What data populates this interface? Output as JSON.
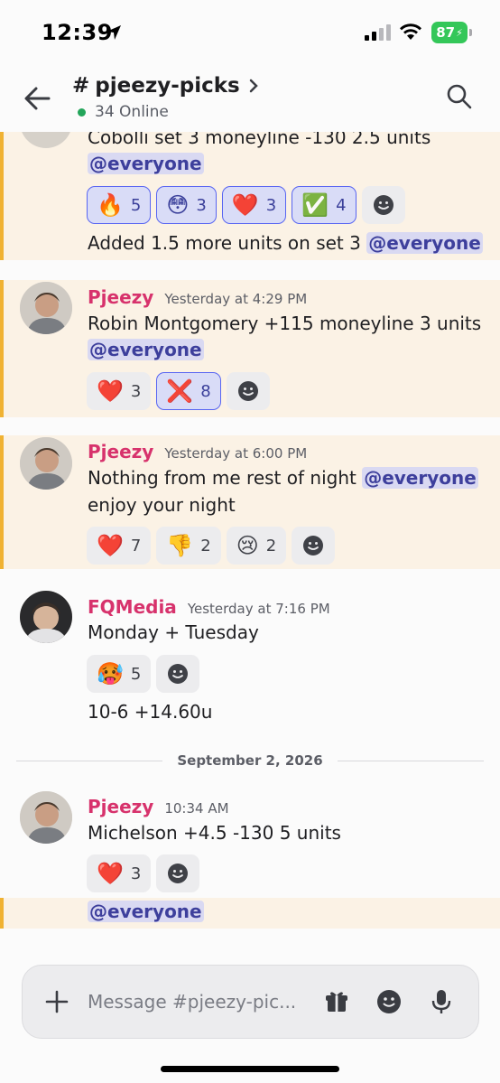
{
  "status_bar": {
    "time": "12:39",
    "battery": "87"
  },
  "header": {
    "channel_hash": "#",
    "channel_name": "pjeezy-picks",
    "online": "34 Online"
  },
  "messages": [
    {
      "lines": [
        "Cobolli set 3 moneyline -130 2.5 units"
      ],
      "mention_line": "@everyone",
      "reactions": [
        {
          "emoji": "🔥",
          "count": "5"
        },
        {
          "emoji": "😳",
          "count": "3"
        },
        {
          "emoji": "❤️",
          "count": "3"
        },
        {
          "emoji": "✅",
          "count": "4"
        }
      ],
      "followup_text": "Added 1.5 more units on set 3 ",
      "followup_mention": "@everyone"
    },
    {
      "author": "Pjeezy",
      "time": "Yesterday at 4:29 PM",
      "text": "Robin Montgomery +115 moneyline 3 units",
      "mention": "@everyone",
      "reactions": [
        {
          "emoji": "❤️",
          "count": "3"
        },
        {
          "emoji": "❌",
          "count": "8"
        }
      ]
    },
    {
      "author": "Pjeezy",
      "time": "Yesterday at 6:00 PM",
      "text": "Nothing from me rest of night ",
      "mention": "@everyone",
      "text2": "enjoy your night",
      "reactions": [
        {
          "emoji": "❤️",
          "count": "7"
        },
        {
          "emoji": "👎",
          "count": "2"
        },
        {
          "emoji": "😢",
          "count": "2"
        }
      ]
    },
    {
      "author": "FQMedia",
      "time": "Yesterday at 7:16 PM",
      "text": "Monday + Tuesday",
      "reactions": [
        {
          "emoji": "🥵",
          "count": "5"
        }
      ],
      "followup_text": "10-6 +14.60u"
    },
    {
      "author": "Pjeezy",
      "time": "10:34 AM",
      "text": "Michelson +4.5 -130 5 units",
      "reactions": [
        {
          "emoji": "❤️",
          "count": "3"
        }
      ],
      "followup_mention": "@everyone"
    }
  ],
  "date_divider": "September 2, 2026",
  "composer": {
    "placeholder": "Message #pjeezy-pic..."
  },
  "colors": {
    "author": "#d7326c",
    "mention_bg": "#d9d9f2",
    "highlight_bg": "#fbf2e5",
    "highlight_bar": "#f0b232",
    "online": "#23a55a"
  }
}
